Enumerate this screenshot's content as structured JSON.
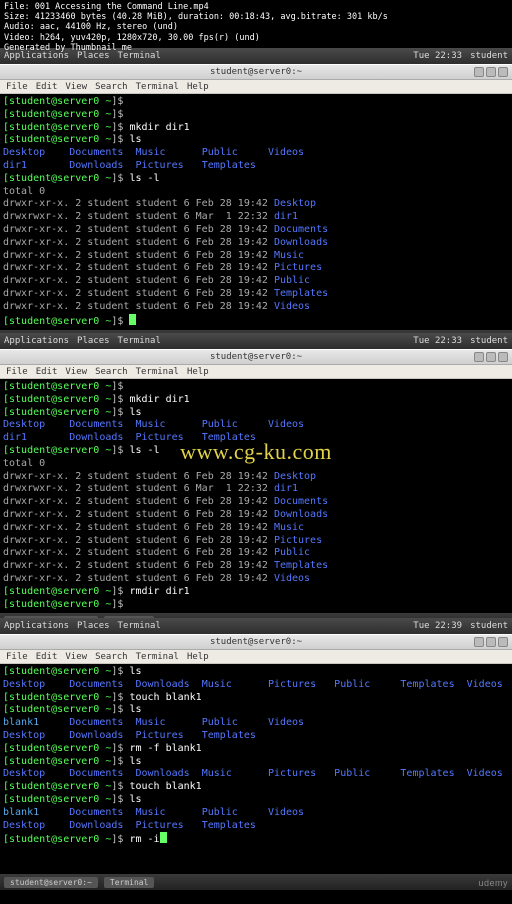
{
  "video_meta": {
    "file": "File: 001 Accessing the Command Line.mp4",
    "size": "Size: 41233460 bytes (40.28 MiB), duration: 00:18:43, avg.bitrate: 301 kb/s",
    "audio": "Audio: aac, 44100 Hz, stereo (und)",
    "video": "Video: h264, yuv420p, 1280x720, 30.00 fps(r) (und)",
    "gen": "Generated by Thumbnail me"
  },
  "watermark": "www.cg-ku.com",
  "udemy": "udemy",
  "gnome": {
    "apps": "Applications",
    "places": "Places",
    "terminal": "Terminal",
    "user": "student"
  },
  "times": {
    "p1": "Tue 22:33",
    "p2": "Tue 22:33",
    "p3": "Tue 22:39"
  },
  "tasktab": "student@server0:~",
  "titlebar": "student@server0:~",
  "menu": {
    "file": "File",
    "edit": "Edit",
    "view": "View",
    "search": "Search",
    "terminal": "Terminal",
    "help": "Help"
  },
  "prompt": {
    "user": "[student@server0",
    "path": " ~",
    "end": "]$"
  },
  "cmds": {
    "empty": "",
    "mkdir": " mkdir dir1",
    "ls": " ls",
    "lsl": " ls -l",
    "rmdir": " rmdir dir1",
    "touch": " touch blank1",
    "rmf": " rm -f blank1",
    "rmi": " rm -i"
  },
  "dirs_two_line": {
    "l1": {
      "a": "Desktop",
      "b": "Documents",
      "c": "Music",
      "d": "Public",
      "e": "Videos"
    },
    "l2": {
      "a": "dir1",
      "b": "Downloads",
      "c": "Pictures",
      "d": "Templates"
    }
  },
  "dirs_blank_two_line": {
    "l1": {
      "a": "blank1",
      "b": "Documents",
      "c": "Music",
      "d": "Public",
      "e": "Videos"
    },
    "l2": {
      "a": "Desktop",
      "b": "Downloads",
      "c": "Pictures",
      "d": "Templates"
    }
  },
  "dirs_one_line": {
    "a": "Desktop",
    "b": "Documents",
    "c": "Downloads",
    "d": "Music",
    "e": "Pictures",
    "f": "Public",
    "g": "Templates",
    "h": "Videos"
  },
  "total": "total 0",
  "ll": [
    {
      "p": "drwxr-xr-x. 2 student student 6 Feb 28 19:42 ",
      "n": "Desktop",
      "c": "blue"
    },
    {
      "p": "drwxrwxr-x. 2 student student 6 Mar  1 22:32 ",
      "n": "dir1",
      "c": "blue"
    },
    {
      "p": "drwxr-xr-x. 2 student student 6 Feb 28 19:42 ",
      "n": "Documents",
      "c": "blue"
    },
    {
      "p": "drwxr-xr-x. 2 student student 6 Feb 28 19:42 ",
      "n": "Downloads",
      "c": "blue"
    },
    {
      "p": "drwxr-xr-x. 2 student student 6 Feb 28 19:42 ",
      "n": "Music",
      "c": "blue"
    },
    {
      "p": "drwxr-xr-x. 2 student student 6 Feb 28 19:42 ",
      "n": "Pictures",
      "c": "blue"
    },
    {
      "p": "drwxr-xr-x. 2 student student 6 Feb 28 19:42 ",
      "n": "Public",
      "c": "blue"
    },
    {
      "p": "drwxr-xr-x. 2 student student 6 Feb 28 19:42 ",
      "n": "Templates",
      "c": "blue"
    },
    {
      "p": "drwxr-xr-x. 2 student student 6 Feb 28 19:42 ",
      "n": "Videos",
      "c": "blue"
    }
  ]
}
